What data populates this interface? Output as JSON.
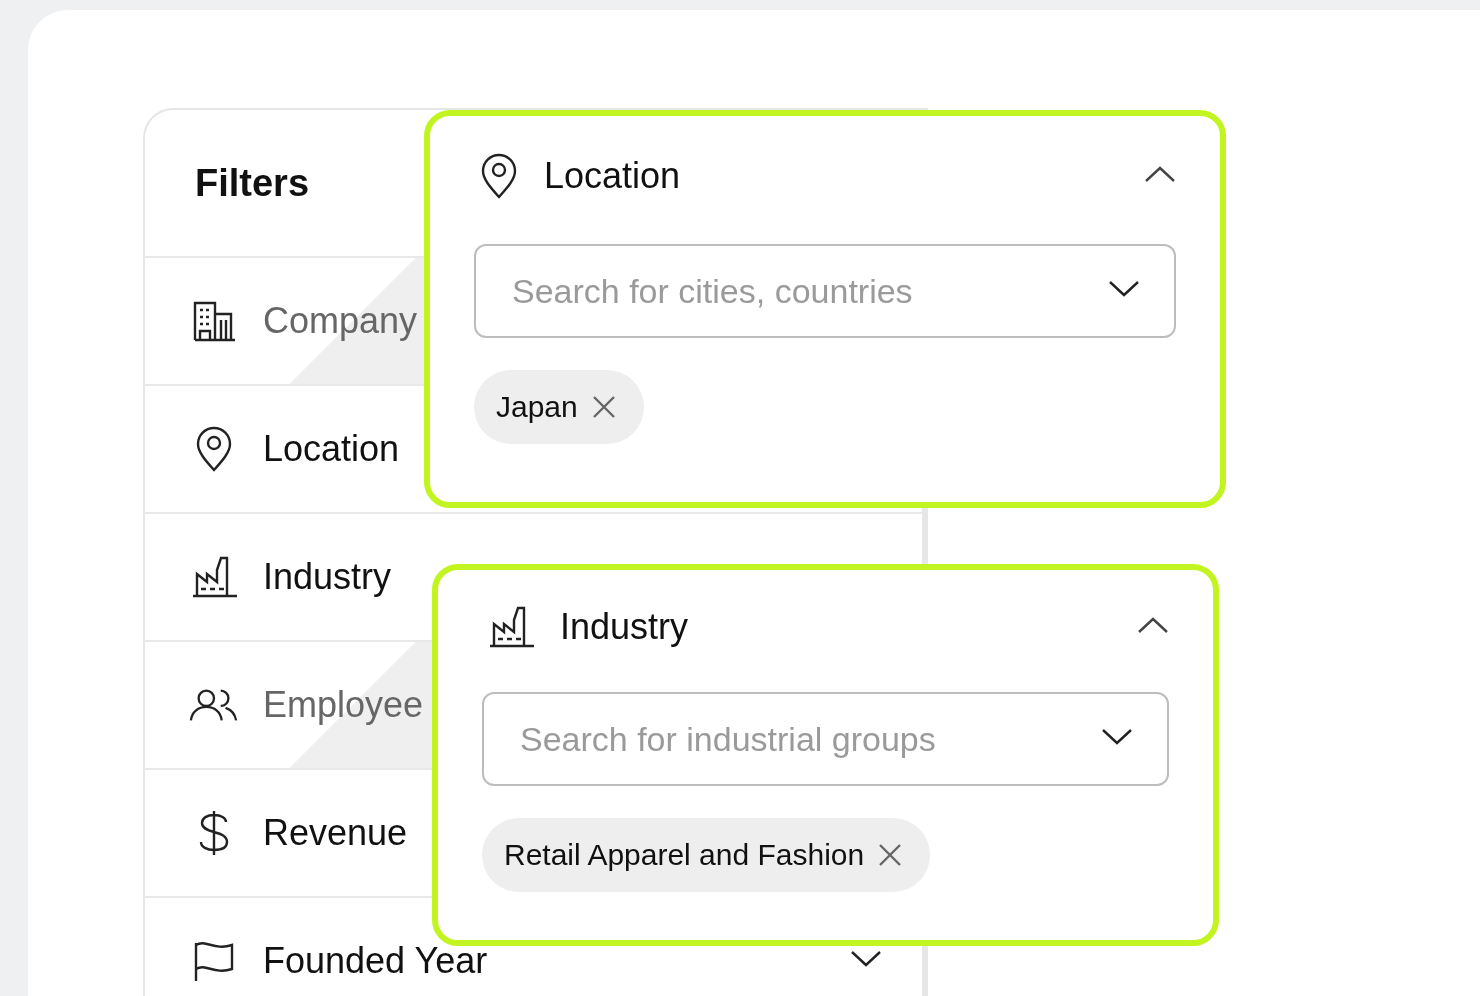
{
  "sidebar": {
    "title": "Filters",
    "items": [
      {
        "label": "Company",
        "kind": "building",
        "dimmed": true
      },
      {
        "label": "Location",
        "kind": "pin",
        "dimmed": false
      },
      {
        "label": "Industry",
        "kind": "factory",
        "dimmed": false
      },
      {
        "label": "Employee",
        "kind": "people",
        "dimmed": true
      },
      {
        "label": "Revenue",
        "kind": "dollar",
        "dimmed": false
      },
      {
        "label": "Founded Year",
        "kind": "flag",
        "dimmed": false,
        "expanded": false
      }
    ]
  },
  "popovers": [
    {
      "title": "Location",
      "kind": "pin",
      "expanded": true,
      "placeholder": "Search for cities, countries",
      "chips": [
        "Japan"
      ]
    },
    {
      "title": "Industry",
      "kind": "factory",
      "expanded": true,
      "placeholder": "Search for industrial groups",
      "chips": [
        "Retail Apparel and Fashion"
      ]
    }
  ]
}
